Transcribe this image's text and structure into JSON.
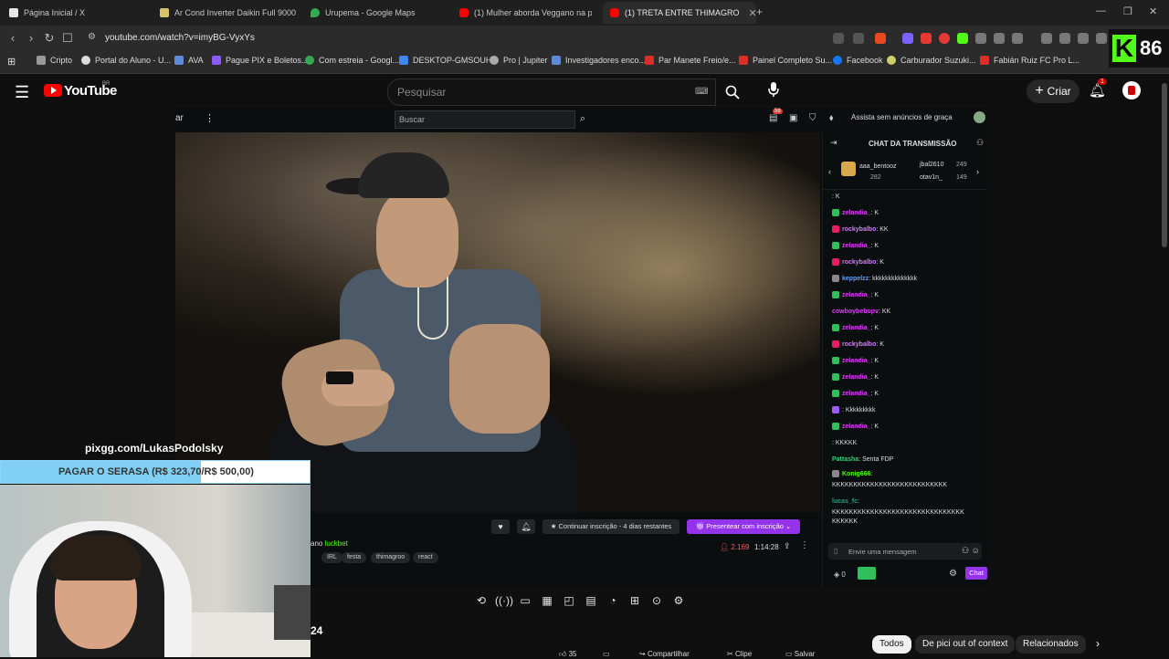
{
  "browser": {
    "tabs": [
      {
        "label": "Página Inicial / X",
        "color": "#e7e7e7"
      },
      {
        "label": "Ar Cond Inverter Daikin Full 9000 Bt",
        "color": "#d9c36a"
      },
      {
        "label": "Urupema - Google Maps",
        "color": "#34a853"
      },
      {
        "label": "(1) Mulher aborda Veggano na praia",
        "color": "#ff0000"
      },
      {
        "label": "(1) TRETA ENTRE THIMAGRO",
        "color": "#ff0000"
      }
    ],
    "new_tab": "+",
    "url": "youtube.com/watch?v=imyBG-VyxYs",
    "bookmarks": [
      {
        "label": "Cripto",
        "color": "#999999"
      },
      {
        "label": "Portal do Aluno - U...",
        "color": "#dddddd"
      },
      {
        "label": "AVA",
        "color": "#5d8bd6"
      },
      {
        "label": "Pague PIX e Boletos...",
        "color": "#8b5cf6"
      },
      {
        "label": "Com estreia - Googl...",
        "color": "#34a853"
      },
      {
        "label": "DESKTOP-GMSOUHF",
        "color": "#4285f4"
      },
      {
        "label": "Pro | Jupiter",
        "color": "#aaaaaa"
      },
      {
        "label": "Investigadores enco...",
        "color": "#5d8bd6"
      },
      {
        "label": "Par Manete Freio/e...",
        "color": "#d93025"
      },
      {
        "label": "Painel Completo Su...",
        "color": "#d93025"
      },
      {
        "label": "Facebook",
        "color": "#1877f2"
      },
      {
        "label": "Carburador Suzuki...",
        "color": "#cfcf6a"
      },
      {
        "label": "Fabián Ruiz FC Pro L...",
        "color": "#d93025"
      }
    ]
  },
  "kick_badge": {
    "letter": "K",
    "count": "86"
  },
  "youtube": {
    "logo": "YouTube",
    "country": "BR",
    "search_placeholder": "Pesquisar",
    "create_label": "Criar",
    "notif_count": "1",
    "chips": [
      {
        "label": "Todos",
        "selected": true
      },
      {
        "label": "De pici out of context",
        "selected": false
      },
      {
        "label": "Relacionados",
        "selected": false
      }
    ],
    "actions": [
      "35",
      "Compartilhar",
      "Clipe",
      "Salvar"
    ]
  },
  "kick": {
    "cut_label": "ar",
    "search_placeholder": "Buscar",
    "notif_badge": "56",
    "adfree": "Assista sem anúncios de graça",
    "username": "luckbet",
    "tags": [
      "IRL",
      "festa",
      "thimagroo",
      "react"
    ],
    "continue_label": "Continuar inscrição - 4 dias restantes",
    "gift_label": "Presentear com inscrição",
    "viewers": "2.169",
    "uptime": "1:14:28",
    "chat": {
      "title": "CHAT DA TRANSMISSÃO",
      "gifters": [
        {
          "name": "aaa_bentooz",
          "count": "282"
        },
        {
          "name": "jbal2610",
          "count": "249"
        },
        {
          "name": "otav1n_",
          "count": "149"
        }
      ],
      "messages": [
        {
          "name": "",
          "text": ": K",
          "color": "#e040fb",
          "badge": ""
        },
        {
          "name": "zelandia_",
          "text": ": K",
          "color": "#e040fb",
          "badge": "#2fbf5b"
        },
        {
          "name": "rockybalbo",
          "text": ": KK",
          "color": "#d47bff",
          "badge": "#e91e63"
        },
        {
          "name": "zelandia_",
          "text": ": K",
          "color": "#e040fb",
          "badge": "#2fbf5b"
        },
        {
          "name": "rockybalbo",
          "text": ": K",
          "color": "#d47bff",
          "badge": "#e91e63"
        },
        {
          "name": "keppelzz",
          "text": ": kkkkkkkkkkkkkk",
          "color": "#5ea0ff",
          "badge": "#888888"
        },
        {
          "name": "zelandia_",
          "text": ": K",
          "color": "#e040fb",
          "badge": "#2fbf5b"
        },
        {
          "name": "cowboybebopv",
          "text": ": KK",
          "color": "#e040fb",
          "badge": ""
        },
        {
          "name": "zelandia_",
          "text": ": K",
          "color": "#e040fb",
          "badge": "#2fbf5b"
        },
        {
          "name": "rockybalbo",
          "text": ": K",
          "color": "#d47bff",
          "badge": "#e91e63"
        },
        {
          "name": "zelandia_",
          "text": ": K",
          "color": "#e040fb",
          "badge": "#2fbf5b"
        },
        {
          "name": "zelandia_",
          "text": ": K",
          "color": "#e040fb",
          "badge": "#2fbf5b"
        },
        {
          "name": "zelandia_",
          "text": ": K",
          "color": "#e040fb",
          "badge": "#2fbf5b"
        },
        {
          "name": "",
          "text": ": Kkkkkkkkk",
          "color": "#9a5cff",
          "badge": "#9a5cff"
        },
        {
          "name": "zelandia_",
          "text": ": K",
          "color": "#e040fb",
          "badge": "#2fbf5b"
        },
        {
          "name": "",
          "text": ": KKKKK",
          "color": "#2fbf5b",
          "badge": ""
        },
        {
          "name": "Pattasha",
          "text": ": Senta FDP",
          "color": "#2fd27a",
          "badge": ""
        },
        {
          "name": "Konig666",
          "text": ":",
          "color": "#53fc18",
          "badge": "#888888"
        },
        {
          "name": "",
          "text": "KKKKKKKKKKKKKKKKKKKKKKKKKKK",
          "color": "#dddddd",
          "badge": ""
        },
        {
          "name": "lucas_fc",
          "text": ":",
          "color": "#2f9b7a",
          "badge": ""
        },
        {
          "name": "",
          "text": "KKKKKKKKKKKKKKKKKKKKKKKKKKKKKKK",
          "color": "#dddddd",
          "badge": ""
        },
        {
          "name": "",
          "text": "KKKKKK",
          "color": "#dddddd",
          "badge": ""
        }
      ],
      "input_placeholder": "Envie uma mensagem",
      "points": "0",
      "send_label": "Chat"
    }
  },
  "overlay": {
    "donation_url": "pixgg.com/LukasPodolsky",
    "goal_text": "PAGAR O SERASA (R$ 323,70/R$ 500,00)",
    "goal_progress": 0.647,
    "cam_number": "24"
  },
  "colors": {
    "yt_red": "#ff0000",
    "kick_green": "#53fc18",
    "kick_purple": "#9333ea",
    "goal_fill": "#7fd0f4"
  }
}
